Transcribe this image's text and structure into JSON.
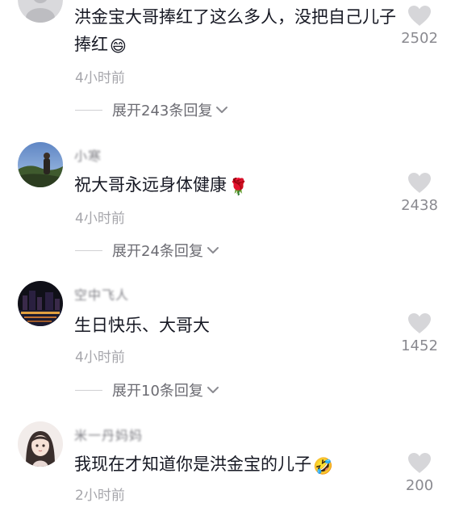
{
  "comments": [
    {
      "username": "",
      "text": "洪金宝大哥捧红了这么多人，没把自己儿子捧红",
      "emoji": "😄",
      "time": "4小时前",
      "reply_label": "展开243条回复",
      "likes": "2502",
      "avatar_icon": "gray-avatar"
    },
    {
      "username": "小寒",
      "text": "祝大哥永远身体健康",
      "emoji": "🌹",
      "time": "4小时前",
      "reply_label": "展开24条回复",
      "likes": "2438",
      "avatar_icon": "landscape-photo-avatar"
    },
    {
      "username": "空中飞人",
      "text": "生日快乐、大哥大",
      "emoji": "",
      "time": "4小时前",
      "reply_label": "展开10条回复",
      "likes": "1452",
      "avatar_icon": "city-night-avatar"
    },
    {
      "username": "米一丹妈妈",
      "text": "我现在才知道你是洪金宝的儿子",
      "emoji": "🤣",
      "time": "2小时前",
      "reply_label": "",
      "likes": "200",
      "avatar_icon": "anime-girl-avatar"
    }
  ],
  "colors": {
    "text": "#161823",
    "muted": "#a6a6ab",
    "heart": "#d6d6d9"
  }
}
